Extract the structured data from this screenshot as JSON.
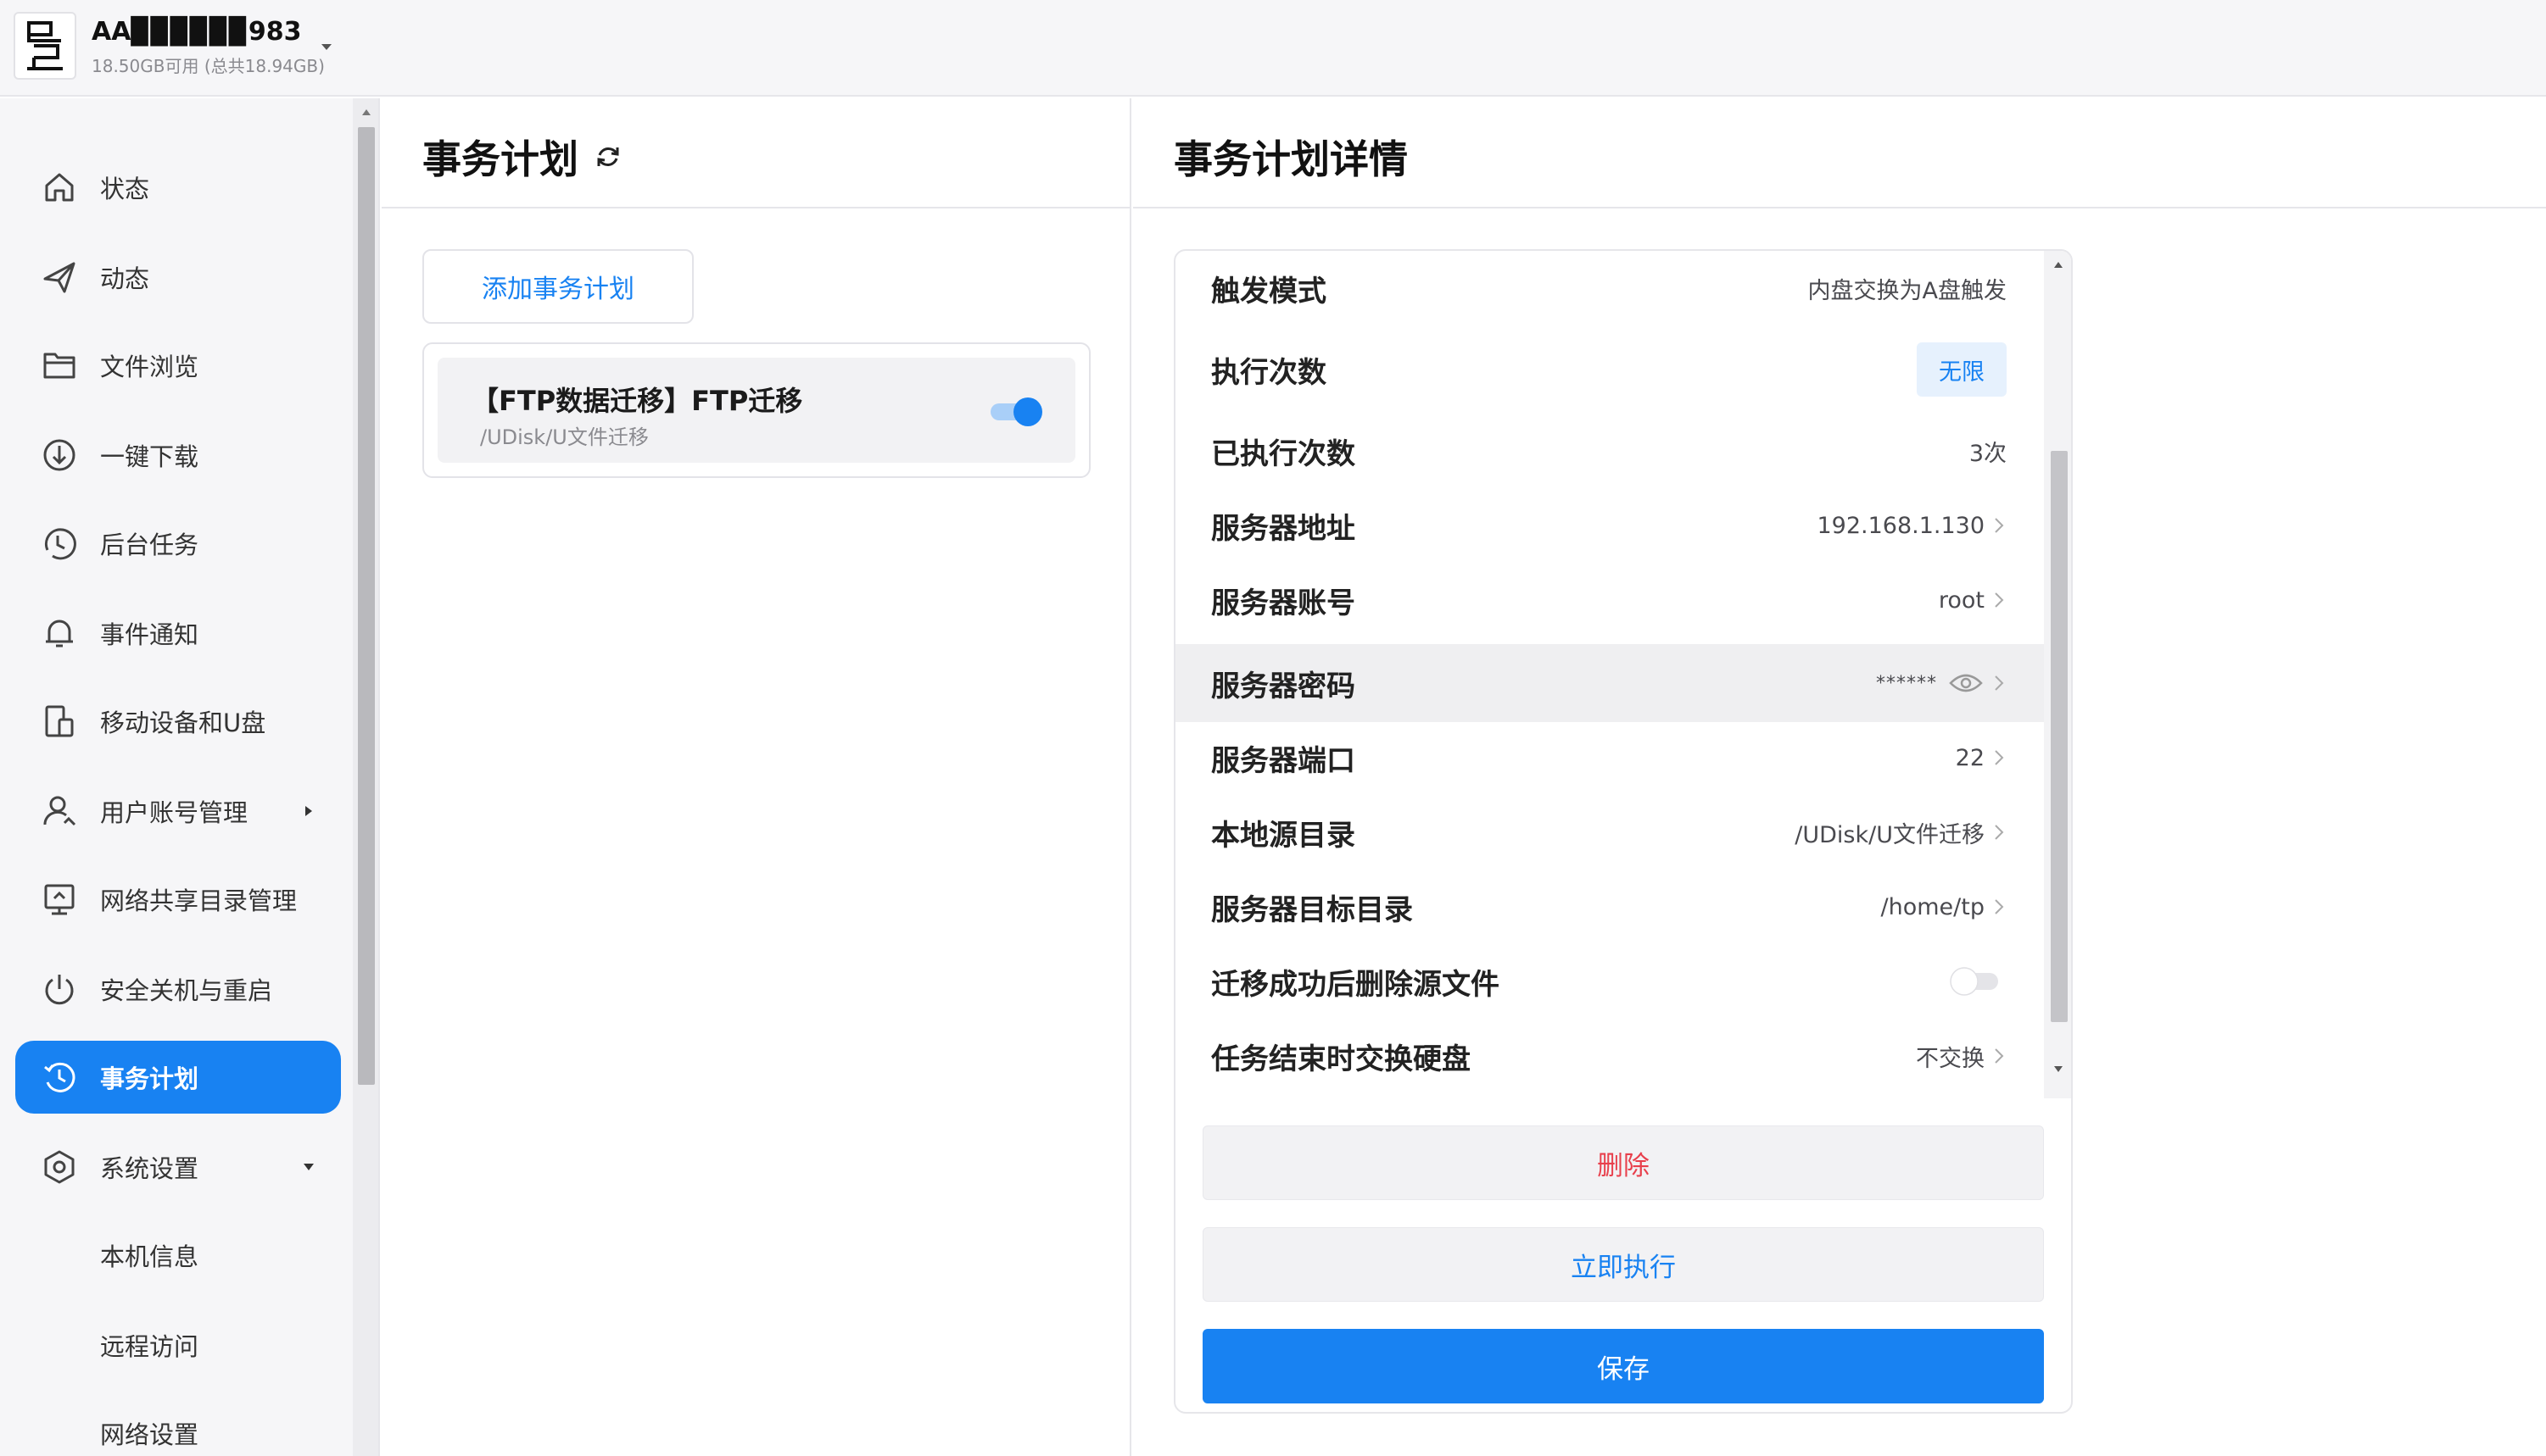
{
  "device": {
    "name": "AA▉▉▉▉▉▉983",
    "storage": "18.50GB可用 (总共18.94GB)"
  },
  "sidebar": {
    "items": [
      {
        "label": "状态",
        "icon": "home-icon"
      },
      {
        "label": "动态",
        "icon": "send-icon"
      },
      {
        "label": "文件浏览",
        "icon": "folder-icon"
      },
      {
        "label": "一键下载",
        "icon": "download-icon"
      },
      {
        "label": "后台任务",
        "icon": "clock-icon"
      },
      {
        "label": "事件通知",
        "icon": "bell-icon"
      },
      {
        "label": "移动设备和U盘",
        "icon": "devices-icon"
      },
      {
        "label": "用户账号管理",
        "icon": "user-icon"
      },
      {
        "label": "网络共享目录管理",
        "icon": "share-icon"
      },
      {
        "label": "安全关机与重启",
        "icon": "power-icon"
      },
      {
        "label": "事务计划",
        "icon": "history-icon",
        "active": true
      },
      {
        "label": "系统设置",
        "icon": "settings-icon"
      },
      {
        "label": "本机信息"
      },
      {
        "label": "远程访问"
      },
      {
        "label": "网络设置"
      }
    ]
  },
  "plans": {
    "title": "事务计划",
    "add_label": "添加事务计划",
    "task": {
      "title": "【FTP数据迁移】FTP迁移",
      "path": "/UDisk/U文件迁移",
      "enabled": true
    }
  },
  "detail": {
    "title": "事务计划详情",
    "rows": [
      {
        "key": "触发模式",
        "value": "内盘交换为A盘触发"
      },
      {
        "key": "执行次数",
        "value": "无限"
      },
      {
        "key": "已执行次数",
        "value": "3次"
      },
      {
        "key": "服务器地址",
        "value": "192.168.1.130"
      },
      {
        "key": "服务器账号",
        "value": "root"
      },
      {
        "key": "服务器密码",
        "value": "******"
      },
      {
        "key": "服务器端口",
        "value": "22"
      },
      {
        "key": "本地源目录",
        "value": "/UDisk/U文件迁移"
      },
      {
        "key": "服务器目标目录",
        "value": "/home/tp"
      },
      {
        "key": "迁移成功后删除源文件",
        "value_toggle": false
      },
      {
        "key": "任务结束时交换硬盘",
        "value": "不交换"
      }
    ],
    "delete_label": "删除",
    "run_label": "立即执行",
    "save_label": "保存"
  },
  "colors": {
    "accent": "#1882f2",
    "danger": "#e8404c",
    "sidebar_bg": "#f6f6f8"
  }
}
